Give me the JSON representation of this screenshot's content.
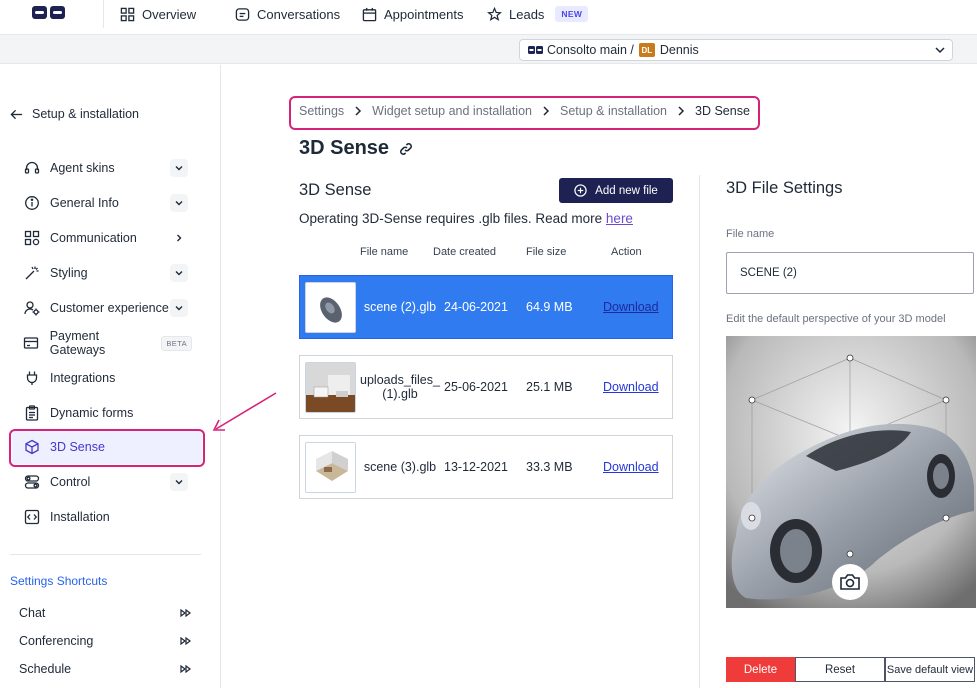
{
  "topnav": {
    "items": [
      {
        "label": "Overview",
        "icon": "grid-icon"
      },
      {
        "label": "Conversations",
        "icon": "chat-icon"
      },
      {
        "label": "Appointments",
        "icon": "calendar-icon"
      },
      {
        "label": "Leads",
        "icon": "stars-icon"
      }
    ],
    "new_badge": "NEW"
  },
  "account": {
    "prefix": "Consolto main /",
    "initials": "DL",
    "name": "Dennis"
  },
  "sidebar": {
    "back_label": "Setup & installation",
    "items": [
      {
        "label": "Agent skins",
        "icon": "headset-icon",
        "caret": "down"
      },
      {
        "label": "General Info",
        "icon": "info-icon",
        "caret": "down"
      },
      {
        "label": "Communication",
        "icon": "apps-icon",
        "caret": "right"
      },
      {
        "label": "Styling",
        "icon": "magic-wand-icon",
        "caret": "down"
      },
      {
        "label": "Customer experience",
        "icon": "user-gear-icon",
        "caret": "down"
      },
      {
        "label": "Payment Gateways",
        "icon": "credit-card-icon",
        "badge": "BETA"
      },
      {
        "label": "Integrations",
        "icon": "plug-icon"
      },
      {
        "label": "Dynamic forms",
        "icon": "clipboard-icon"
      },
      {
        "label": "3D Sense",
        "icon": "cube-icon",
        "active": true
      },
      {
        "label": "Control",
        "icon": "toggle-icon",
        "caret": "down"
      },
      {
        "label": "Installation",
        "icon": "code-icon"
      }
    ],
    "shortcuts_title": "Settings Shortcuts",
    "shortcuts": [
      "Chat",
      "Conferencing",
      "Schedule"
    ]
  },
  "breadcrumb": [
    "Settings",
    "Widget setup and installation",
    "Setup & installation",
    "3D Sense"
  ],
  "page_title": "3D Sense",
  "files_section": {
    "title": "3D Sense",
    "add_button": "Add new file",
    "info_text": "Operating 3D-Sense requires .glb files. Read more",
    "info_link": "here",
    "columns": {
      "name": "File name",
      "date": "Date created",
      "size": "File size",
      "action": "Action"
    },
    "rows": [
      {
        "name": "scene (2).glb",
        "date": "24-06-2021",
        "size": "64.9 MB",
        "action": "Download",
        "selected": true
      },
      {
        "name": "uploads_files_ (1).glb",
        "date": "25-06-2021",
        "size": "25.1 MB",
        "action": "Download"
      },
      {
        "name": "scene (3).glb",
        "date": "13-12-2021",
        "size": "33.3 MB",
        "action": "Download"
      }
    ]
  },
  "settings_panel": {
    "title": "3D File Settings",
    "file_name_label": "File name",
    "file_name_value": "SCENE (2)",
    "perspective_label": "Edit the default perspective of your 3D model",
    "buttons": {
      "delete": "Delete",
      "reset": "Reset",
      "save": "Save default view"
    }
  },
  "colors": {
    "accent": "#1e2252",
    "selected_row": "#2f7bef",
    "highlight_outline": "#d6237a",
    "delete": "#f03b3b",
    "active_item": "#4338ca"
  }
}
